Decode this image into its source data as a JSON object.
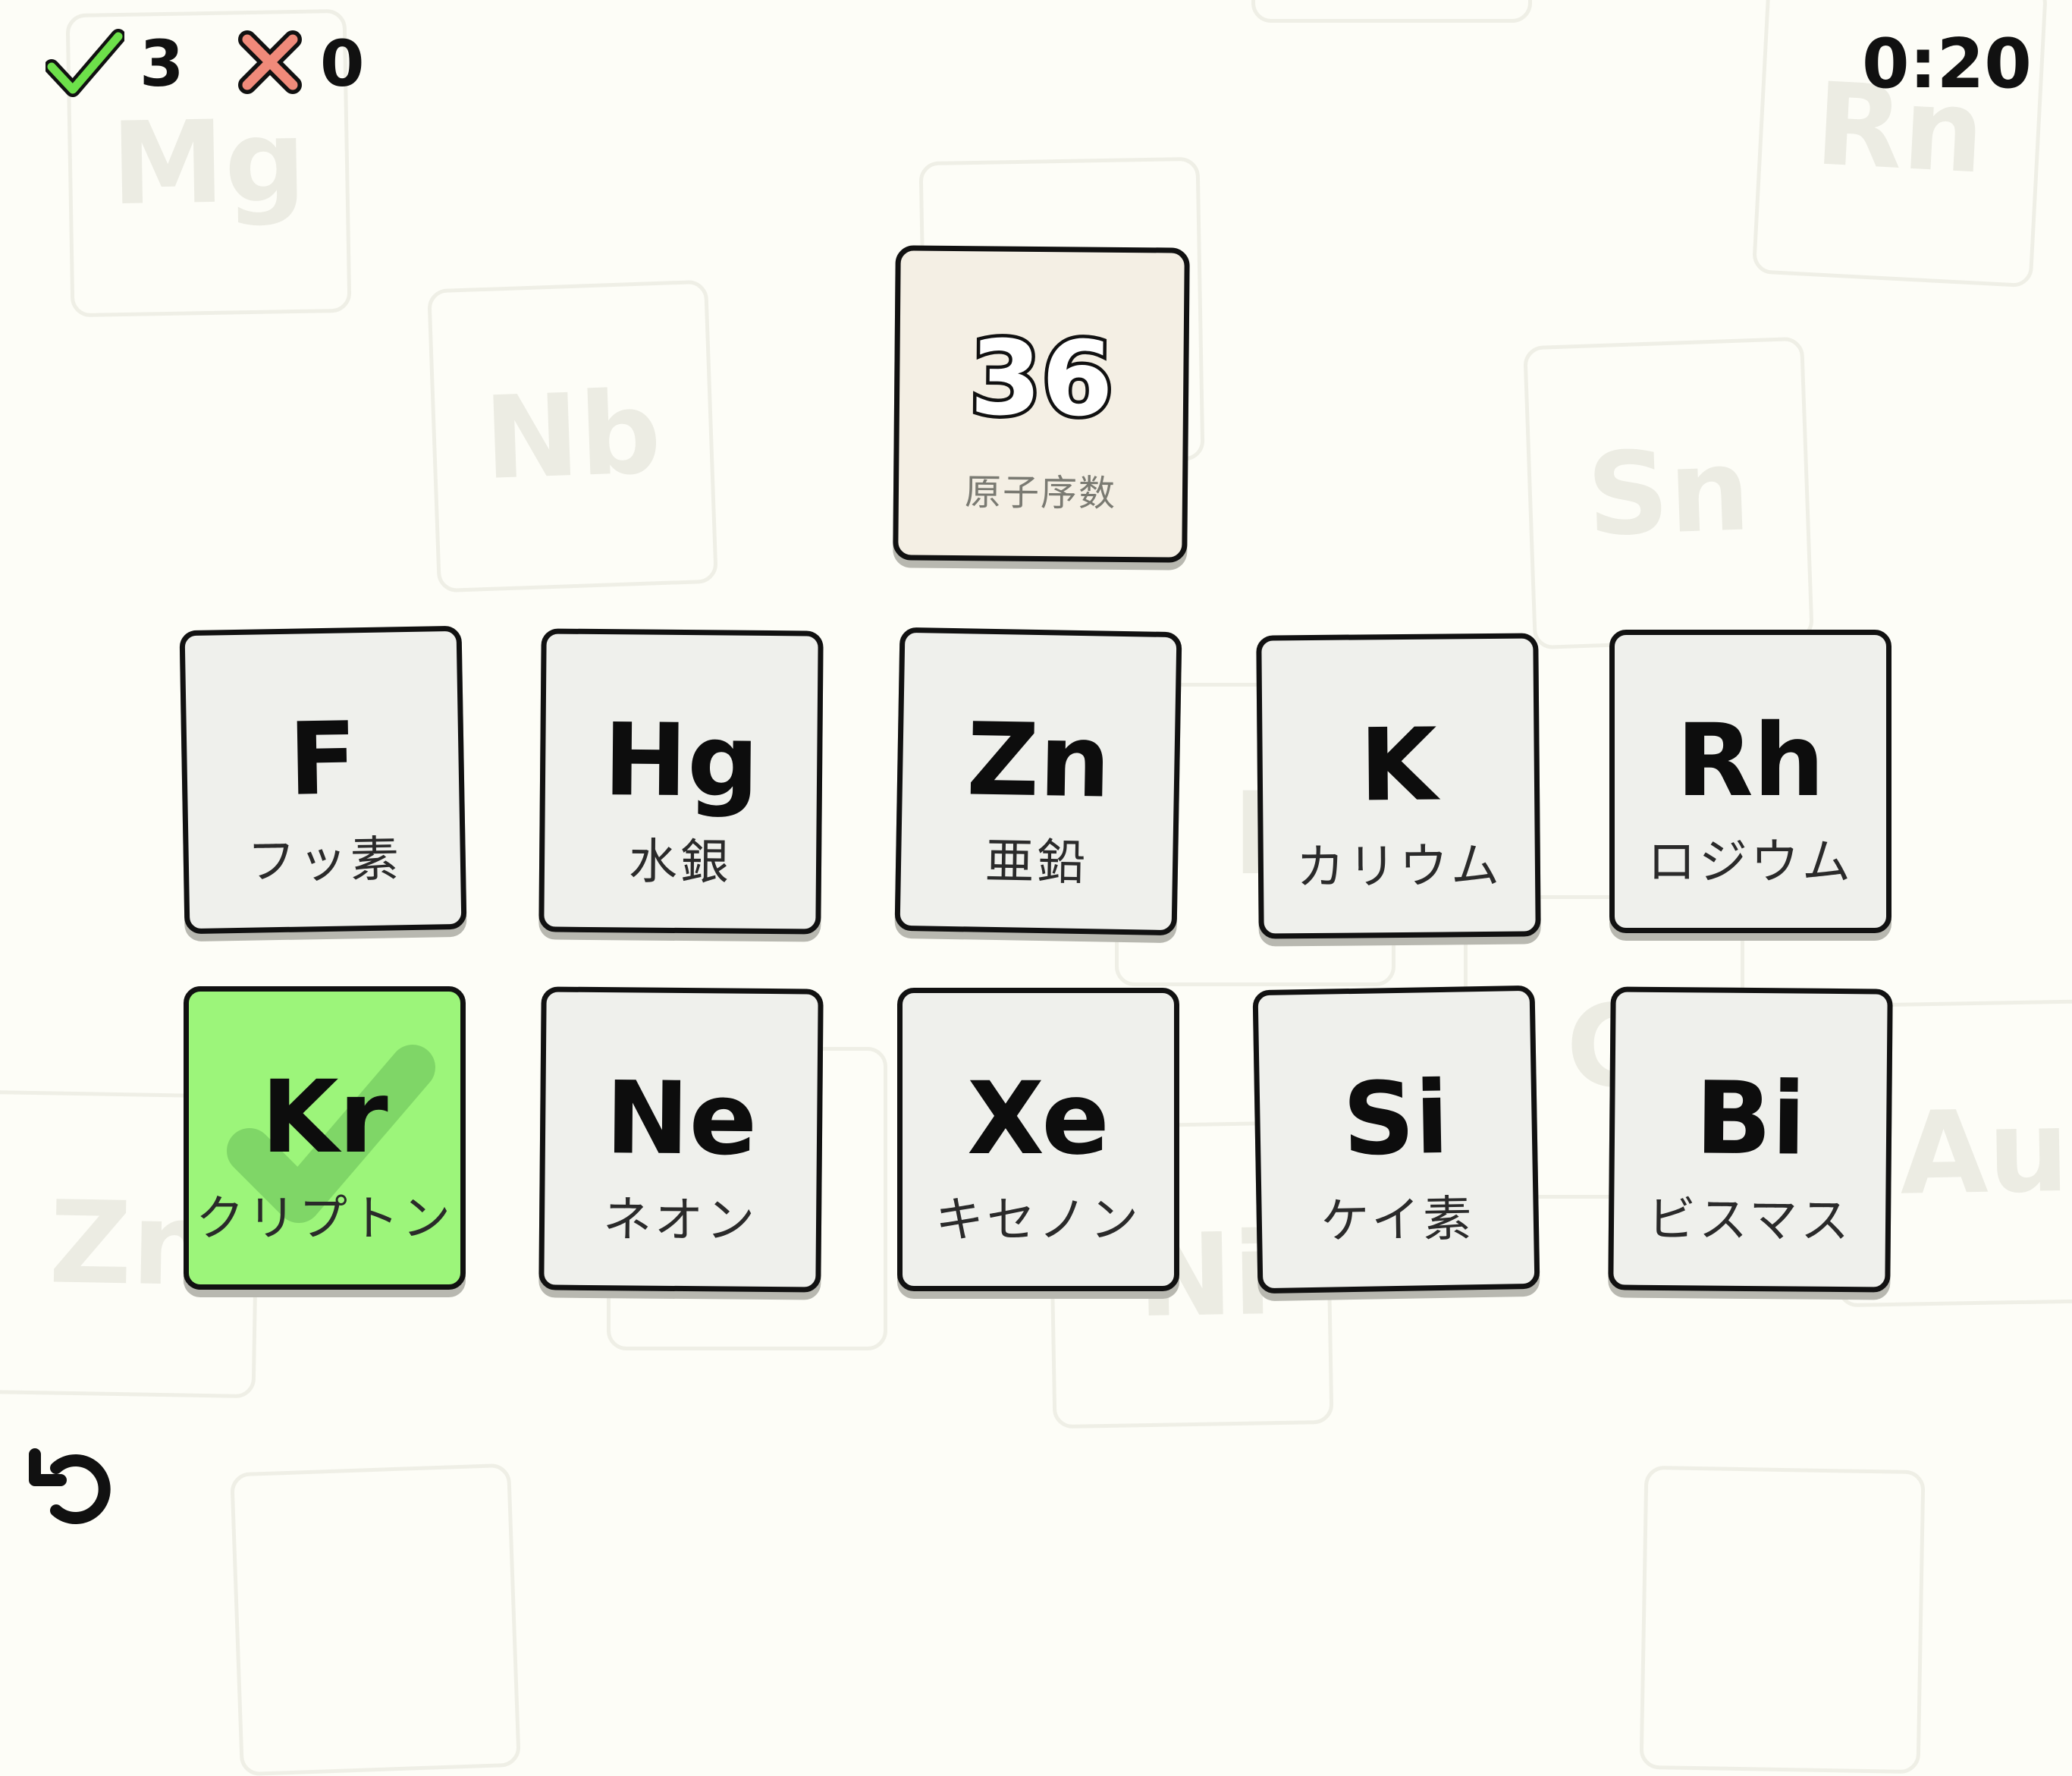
{
  "score": {
    "correct": "3",
    "wrong": "0"
  },
  "timer": "0:20",
  "prompt": {
    "number": "36",
    "caption": "原子序数"
  },
  "tiles": [
    {
      "symbol": "F",
      "name": "フッ素"
    },
    {
      "symbol": "Hg",
      "name": "水銀"
    },
    {
      "symbol": "Zn",
      "name": "亜鉛"
    },
    {
      "symbol": "K",
      "name": "カリウム"
    },
    {
      "symbol": "Rh",
      "name": "ロジウム"
    },
    {
      "symbol": "Kr",
      "name": "クリプトン",
      "state": "correct"
    },
    {
      "symbol": "Ne",
      "name": "ネオン"
    },
    {
      "symbol": "Xe",
      "name": "キセノン"
    },
    {
      "symbol": "Si",
      "name": "ケイ素"
    },
    {
      "symbol": "Bi",
      "name": "ビスマス"
    }
  ],
  "background_tiles": [
    "Mg",
    "Nb",
    "Rn",
    "Sn",
    "Zn",
    "Au",
    "Ni",
    "Fe",
    "C"
  ],
  "colors": {
    "background": "#fdfdf7",
    "correct": "#9cf57a",
    "check": "#6de04a",
    "cross": "#f08a7a"
  },
  "icons": {
    "correct": "check-icon",
    "wrong": "cross-icon",
    "restart": "restart-icon"
  }
}
